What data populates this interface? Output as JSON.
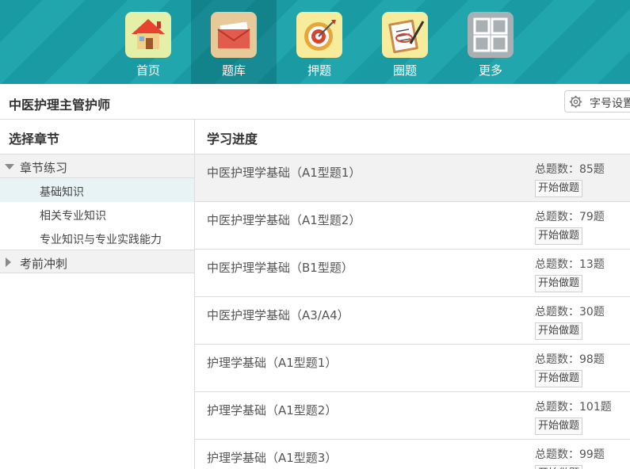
{
  "nav": {
    "items": [
      {
        "label": "首页",
        "icon": "home-icon"
      },
      {
        "label": "题库",
        "icon": "mail-icon"
      },
      {
        "label": "押题",
        "icon": "target-icon"
      },
      {
        "label": "圈题",
        "icon": "clipboard-icon"
      },
      {
        "label": "更多",
        "icon": "grid-icon"
      }
    ],
    "active_index": 1
  },
  "title_bar": {
    "title": "中医护理主管护师",
    "font_button_label": "字号设置"
  },
  "left_panel": {
    "header": "选择章节",
    "chapters": [
      {
        "label": "章节练习",
        "expanded": true,
        "items": [
          "基础知识",
          "相关专业知识",
          "专业知识与专业实践能力"
        ],
        "active_item": 0
      },
      {
        "label": "考前冲刺",
        "expanded": false,
        "items": []
      }
    ]
  },
  "right_panel": {
    "header": "学习进度",
    "start_label": "开始做题",
    "rows": [
      {
        "title": "中医护理学基础（A1型题1）",
        "count": "总题数：85题"
      },
      {
        "title": "中医护理学基础（A1型题2）",
        "count": "总题数：79题"
      },
      {
        "title": "中医护理学基础（B1型题）",
        "count": "总题数：13题"
      },
      {
        "title": "中医护理学基础（A3/A4）",
        "count": "总题数：30题"
      },
      {
        "title": "护理学基础（A1型题1）",
        "count": "总题数：98题"
      },
      {
        "title": "护理学基础（A1型题2）",
        "count": "总题数：101题"
      },
      {
        "title": "护理学基础（A1型题3）",
        "count": "总题数：99题"
      }
    ]
  },
  "colors": {
    "nav_bg": "#1a9aa3",
    "panel_border": "#dcdcdc",
    "active_item_bg": "#e8f3f5"
  }
}
